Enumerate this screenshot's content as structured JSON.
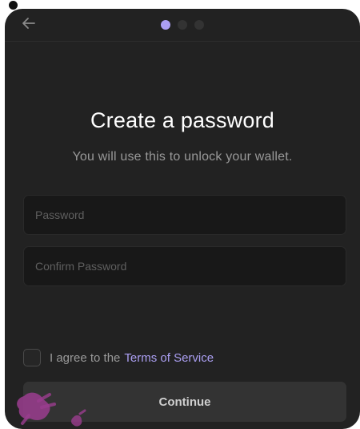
{
  "header": {
    "back_icon": "arrow-left-icon",
    "steps": [
      {
        "state": "active"
      },
      {
        "state": "inactive"
      },
      {
        "state": "inactive"
      }
    ]
  },
  "main": {
    "title": "Create a password",
    "subtitle": "You will use this to unlock your wallet.",
    "password_placeholder": "Password",
    "password_value": "",
    "confirm_placeholder": "Confirm Password",
    "confirm_value": ""
  },
  "agreement": {
    "checked": false,
    "prefix": "I agree to the",
    "link_label": "Terms of Service"
  },
  "footer": {
    "continue_label": "Continue"
  },
  "colors": {
    "panel_background": "#222222",
    "accent": "#ab9ff2",
    "input_background": "#181818",
    "button_background": "#333333",
    "watermark": "#9b3d8f"
  }
}
